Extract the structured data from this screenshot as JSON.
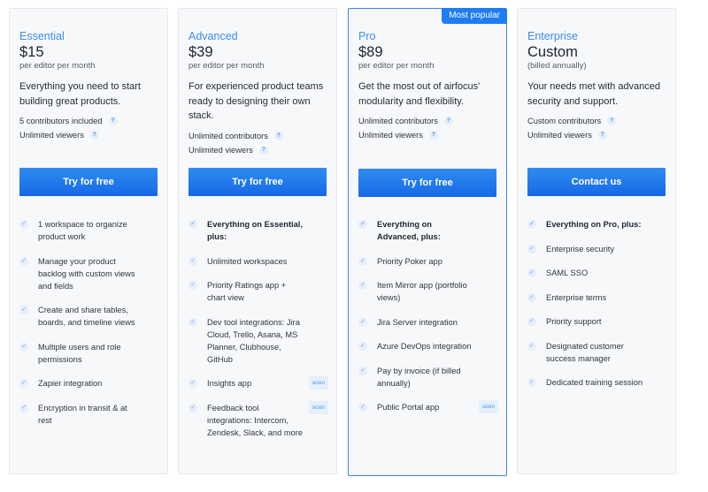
{
  "plans": [
    {
      "name": "Essential",
      "price": "$15",
      "price_note": "per editor per month",
      "description": "Everything you need to start building great products.",
      "meta": [
        "5 contributors included",
        "Unlimited viewers"
      ],
      "cta": "Try for free",
      "features": [
        {
          "text": "1 workspace to organize product work"
        },
        {
          "text": "Manage your product backlog with custom views and fields"
        },
        {
          "text": "Create and share tables, boards, and timeline views"
        },
        {
          "text": "Multiple users and role permissions"
        },
        {
          "text": "Zapier integration"
        },
        {
          "text": "Encryption in transit & at rest"
        }
      ]
    },
    {
      "name": "Advanced",
      "price": "$39",
      "price_note": "per editor per month",
      "description": "For experienced product teams ready to designing their own stack.",
      "meta": [
        "Unlimited contributors",
        "Unlimited viewers"
      ],
      "cta": "Try for free",
      "features": [
        {
          "text": "Everything on Essential, plus:",
          "bold": true
        },
        {
          "text": "Unlimited workspaces"
        },
        {
          "text": "Priority Ratings app + chart view"
        },
        {
          "text": "Dev tool integrations: Jira Cloud, Trello, Asana, MS Planner, Clubhouse, GitHub"
        },
        {
          "text": "Insights app",
          "soon": "soon"
        },
        {
          "text": "Feedback tool integrations: Intercom, Zendesk, Slack, and more",
          "soon": "soon"
        }
      ]
    },
    {
      "name": "Pro",
      "badge": "Most popular",
      "price": "$89",
      "price_note": "per editor per month",
      "description": "Get the most out of airfocus' modularity and flexibility.",
      "meta": [
        "Unlimited contributors",
        "Unlimited viewers"
      ],
      "cta": "Try for free",
      "features": [
        {
          "text": "Everything on Advanced, plus:",
          "bold": true
        },
        {
          "text": "Priority Poker app"
        },
        {
          "text": "Item Mirror app (portfolio views)"
        },
        {
          "text": "Jira Server integration"
        },
        {
          "text": "Azure DevOps integration"
        },
        {
          "text": "Pay by invoice (if billed annually)"
        },
        {
          "text": "Public Portal app",
          "soon": "soon"
        }
      ]
    },
    {
      "name": "Enterprise",
      "price": "Custom",
      "price_note": "(billed annually)",
      "description": "Your needs met with advanced security and support.",
      "meta": [
        "Custom contributors",
        "Unlimited viewers"
      ],
      "cta": "Contact us",
      "features": [
        {
          "text": "Everything on Pro, plus:",
          "bold": true
        },
        {
          "text": "Enterprise security"
        },
        {
          "text": "SAML SSO"
        },
        {
          "text": "Enterprise terms"
        },
        {
          "text": "Priority support"
        },
        {
          "text": "Designated customer success manager"
        },
        {
          "text": "Dedicated training session"
        }
      ]
    }
  ],
  "icons": {
    "help": "?",
    "check": "✓"
  },
  "colors": {
    "accent": "#1f7cf2",
    "plan_name": "#3b8cf3",
    "card_bg": "#f7f8fa"
  }
}
